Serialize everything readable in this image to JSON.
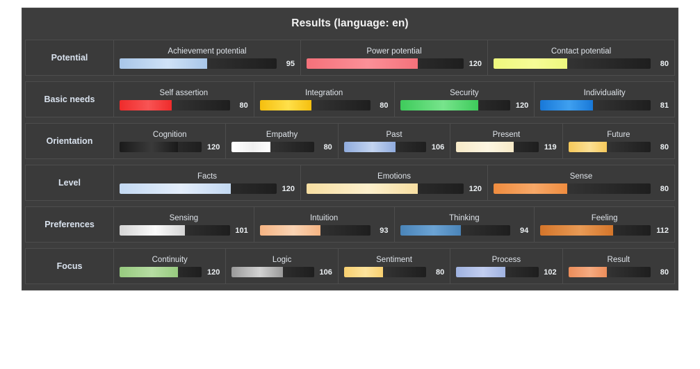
{
  "panel": {
    "title": "Results (language: en)",
    "scale_max": 170
  },
  "chart_data": {
    "type": "bar",
    "title": "Results (language: en)",
    "xlabel": "",
    "ylabel": "",
    "xlim": [
      0,
      170
    ],
    "grid": false,
    "legend": "none",
    "orientation": "horizontal",
    "groups": [
      {
        "label": "Potential",
        "items": [
          {
            "name": "Achievement potential",
            "value": 95,
            "color_start": "#a8c6e8",
            "color_end": "#cfe2f7"
          },
          {
            "name": "Power potential",
            "value": 120,
            "color_start": "#f4717a",
            "color_end": "#fb9098"
          },
          {
            "name": "Contact potential",
            "value": 80,
            "color_start": "#eef87e",
            "color_end": "#f6fc96"
          }
        ]
      },
      {
        "label": "Basic needs",
        "items": [
          {
            "name": "Self assertion",
            "value": 80,
            "color_start": "#ef2b2b",
            "color_end": "#f85454"
          },
          {
            "name": "Integration",
            "value": 80,
            "color_start": "#f5bf0e",
            "color_end": "#ffe04a"
          },
          {
            "name": "Security",
            "value": 120,
            "color_start": "#3ecb5b",
            "color_end": "#77e48c"
          },
          {
            "name": "Individuality",
            "value": 81,
            "color_start": "#1878d8",
            "color_end": "#3fa0f0"
          }
        ]
      },
      {
        "label": "Orientation",
        "items": [
          {
            "name": "Cognition",
            "value": 120,
            "color_start": "#1a1a1a",
            "color_end": "#3a3a3a"
          },
          {
            "name": "Empathy",
            "value": 80,
            "color_start": "#ffffff",
            "color_end": "#f0f0f0"
          },
          {
            "name": "Past",
            "value": 106,
            "color_start": "#8fabdd",
            "color_end": "#c3d4f0"
          },
          {
            "name": "Present",
            "value": 119,
            "color_start": "#f7eac8",
            "color_end": "#fdf6e2"
          },
          {
            "name": "Future",
            "value": 80,
            "color_start": "#f6c košt"
          }
        ]
      },
      {
        "label": "Level",
        "items": [
          {
            "name": "Facts",
            "value": 120,
            "color_start": "#c3d9f2",
            "color_end": "#e4eefb"
          },
          {
            "name": "Emotions",
            "value": 120,
            "color_start": "#f7dfa2",
            "color_end": "#fdf0cd"
          },
          {
            "name": "Sense",
            "value": 80,
            "color_start": "#ef8c3f",
            "color_end": "#f7a868"
          }
        ]
      },
      {
        "label": "Preferences",
        "items": [
          {
            "name": "Sensing",
            "value": 101,
            "color_start": "#d4d4d4",
            "color_end": "#fbfbfb"
          },
          {
            "name": "Intuition",
            "value": 93,
            "color_start": "#f5b483",
            "color_end": "#fad4b4"
          },
          {
            "name": "Thinking",
            "value": 94,
            "color_start": "#4a84b8",
            "color_end": "#6ba3d4"
          },
          {
            "name": "Feeling",
            "value": 112,
            "color_start": "#d4752a",
            "color_end": "#e89a55"
          }
        ]
      },
      {
        "label": "Focus",
        "items": [
          {
            "name": "Continuity",
            "value": 120,
            "color_start": "#97ca7f",
            "color_end": "#b6dca2"
          },
          {
            "name": "Logic",
            "value": 106,
            "color_start": "#9a9a9a",
            "color_end": "#d2d2d2"
          },
          {
            "name": "Sentiment",
            "value": 80,
            "color_start": "#f8d070",
            "color_end": "#fde39c"
          },
          {
            "name": "Process",
            "value": 102,
            "color_start": "#9fb2e0",
            "color_end": "#c2cef0"
          },
          {
            "name": "Result",
            "value": 80,
            "color_start": "#ec8d5a",
            "color_end": "#f5ab81"
          }
        ]
      }
    ]
  }
}
